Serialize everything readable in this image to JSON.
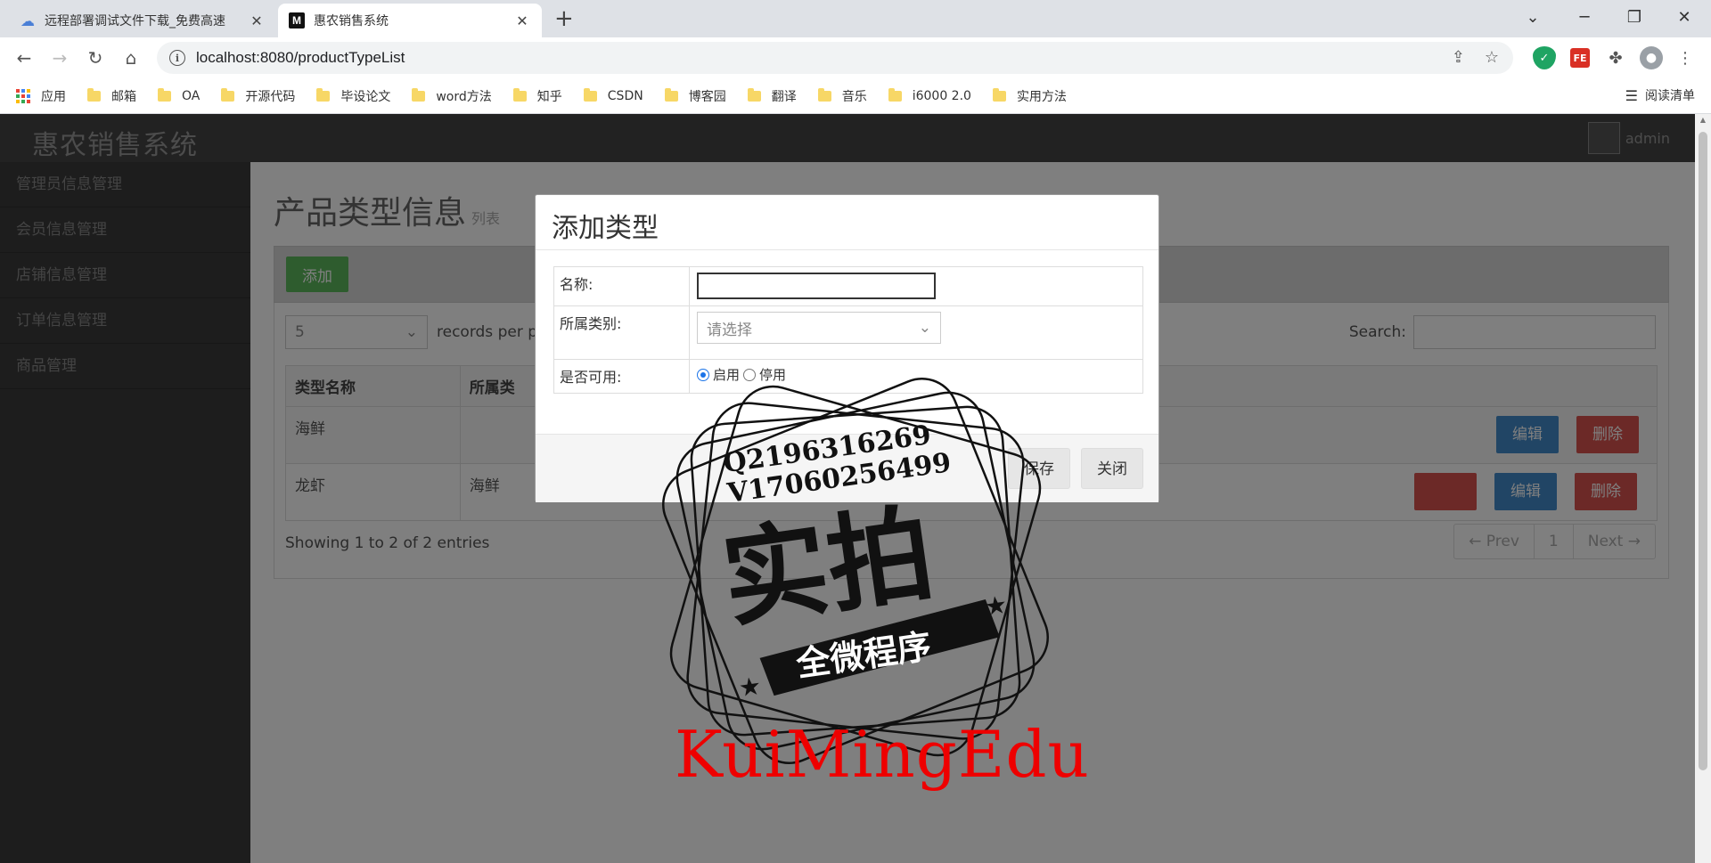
{
  "browser": {
    "tabs": [
      {
        "title": "远程部署调试文件下载_免费高速",
        "active": false
      },
      {
        "title": "惠农销售系统",
        "active": true
      }
    ],
    "url": "localhost:8080/productTypeList",
    "bookmarks": [
      "应用",
      "邮箱",
      "OA",
      "开源代码",
      "毕设论文",
      "word方法",
      "知乎",
      "CSDN",
      "博客园",
      "翻译",
      "音乐",
      "i6000 2.0",
      "实用方法"
    ],
    "reading_list": "阅读清单"
  },
  "app": {
    "brand": "惠农销售系统",
    "user": "admin",
    "sidebar": [
      "管理员信息管理",
      "会员信息管理",
      "店铺信息管理",
      "订单信息管理",
      "商品管理"
    ],
    "page_title": "产品类型信息",
    "page_subtitle": "列表",
    "add_button": "添加",
    "length_value": "5",
    "length_label": "records per page",
    "search_label": "Search:",
    "columns": [
      "类型名称",
      "所属类"
    ],
    "rows": [
      {
        "name": "海鲜",
        "parent": ""
      },
      {
        "name": "龙虾",
        "parent": "海鲜"
      }
    ],
    "edit_label": "编辑",
    "delete_label": "删除",
    "info": "Showing 1 to 2 of 2 entries",
    "pager": {
      "prev": "← Prev",
      "page": "1",
      "next": "Next →"
    }
  },
  "modal": {
    "title": "添加类型",
    "fields": {
      "name_label": "名称:",
      "name_value": "",
      "type_label": "所属类别:",
      "type_placeholder": "请选择",
      "enabled_label": "是否可用:",
      "enabled_on": "启用",
      "enabled_off": "停用",
      "enabled_selected": "启用"
    },
    "save": "保存",
    "close": "关闭"
  },
  "watermark": {
    "qq": "Q2196316269",
    "vx": "V17060256499",
    "stamp_main": "实拍",
    "stamp_banner": "全微程序",
    "brand_text": "KuiMingEdu"
  },
  "colors": {
    "add": "#5cb85c",
    "edit": "#428bca",
    "delete": "#d9534f",
    "watermark_red": "#e00000"
  }
}
